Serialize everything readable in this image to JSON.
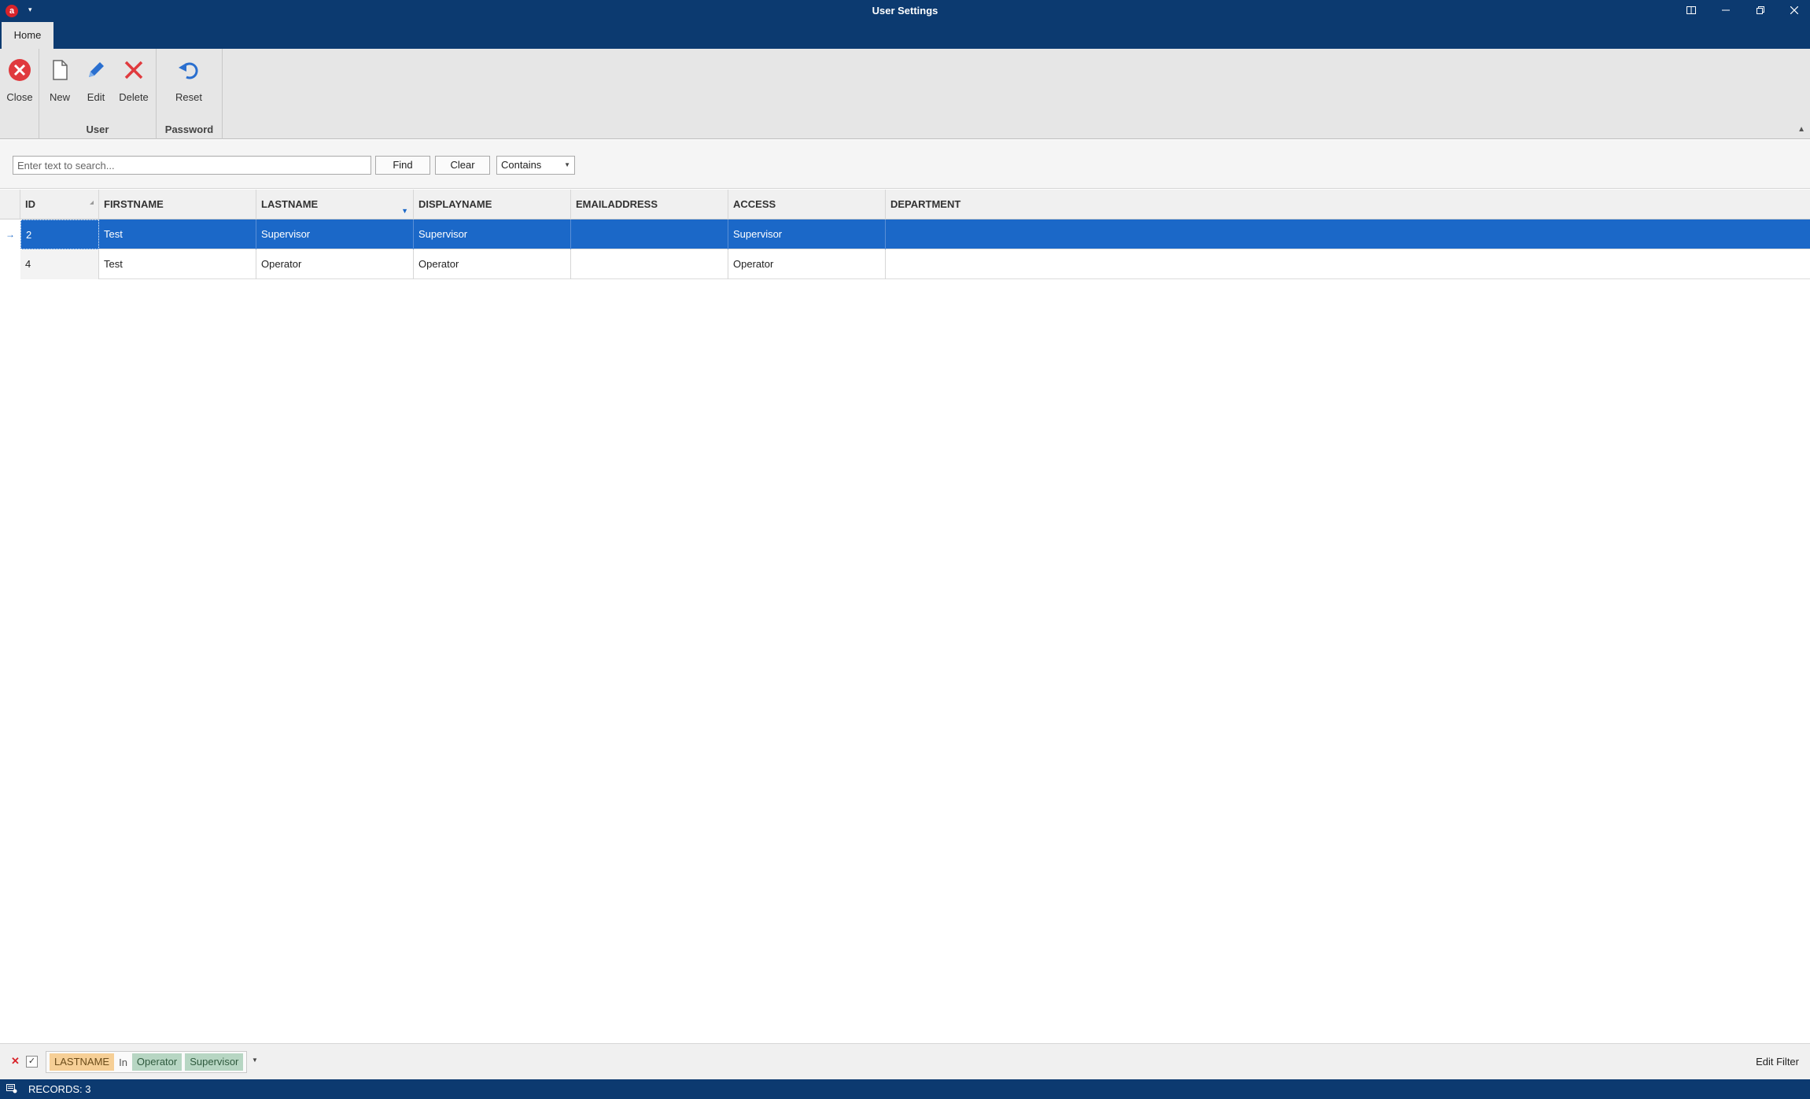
{
  "window": {
    "title": "User Settings",
    "logo_letter": "a",
    "controls": [
      "restore-layout",
      "minimize",
      "maximize",
      "close"
    ]
  },
  "ribbon": {
    "tabs": [
      {
        "label": "Home",
        "active": true
      }
    ],
    "groups": [
      {
        "label": "",
        "buttons": [
          {
            "label": "Close",
            "icon": "close-circle-icon"
          }
        ]
      },
      {
        "label": "User",
        "buttons": [
          {
            "label": "New",
            "icon": "new-document-icon"
          },
          {
            "label": "Edit",
            "icon": "pencil-icon"
          },
          {
            "label": "Delete",
            "icon": "delete-x-icon"
          }
        ]
      },
      {
        "label": "Password",
        "buttons": [
          {
            "label": "Reset",
            "icon": "undo-icon"
          }
        ]
      }
    ]
  },
  "search": {
    "placeholder": "Enter text to search...",
    "value": "",
    "find_label": "Find",
    "clear_label": "Clear",
    "match_mode": "Contains"
  },
  "grid": {
    "columns": [
      "ID",
      "FIRSTNAME",
      "LASTNAME",
      "DISPLAYNAME",
      "EMAILADDRESS",
      "ACCESS",
      "DEPARTMENT"
    ],
    "sorted_column": "ID",
    "filtered_column": "LASTNAME",
    "rows": [
      {
        "id": "2",
        "firstname": "Test",
        "lastname": "Supervisor",
        "displayname": "Supervisor",
        "emailaddress": "",
        "access": "Supervisor",
        "department": "",
        "selected": true
      },
      {
        "id": "4",
        "firstname": "Test",
        "lastname": "Operator",
        "displayname": "Operator",
        "emailaddress": "",
        "access": "Operator",
        "department": "",
        "selected": false
      }
    ]
  },
  "filter": {
    "enabled": true,
    "field": "LASTNAME",
    "operator": "In",
    "values": [
      "Operator",
      "Supervisor"
    ],
    "edit_label": "Edit Filter"
  },
  "status": {
    "records_text": "RECORDS: 3"
  },
  "colors": {
    "titlebar": "#0c3a70",
    "selection": "#1b68c8",
    "ribbon_bg": "#e6e6e6",
    "filter_field_chip": "#f6cf96",
    "filter_value_chip": "#b7d6c3"
  }
}
